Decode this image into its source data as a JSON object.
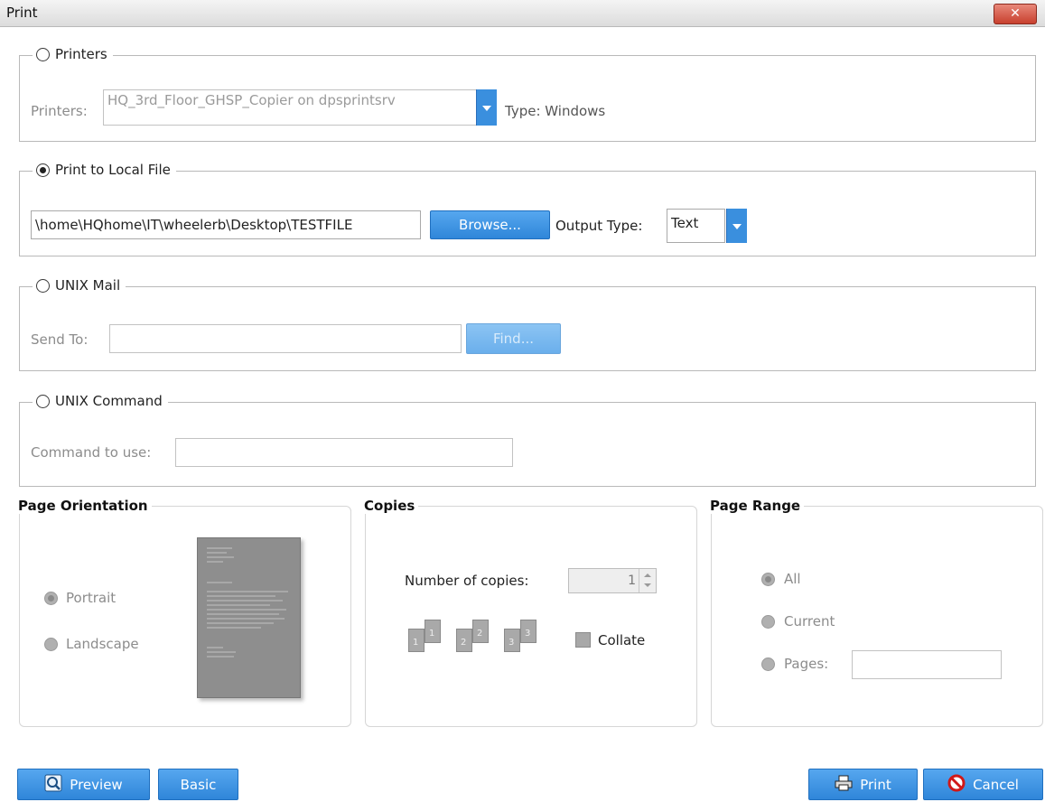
{
  "window": {
    "title": "Print",
    "close_label": "✕"
  },
  "printers": {
    "legend": "Printers",
    "label": "Printers:",
    "value": "HQ_3rd_Floor_GHSP_Copier on dpsprintsrv",
    "type_text": "Type: Windows"
  },
  "local_file": {
    "legend": "Print to Local File",
    "path": "\\home\\HQhome\\IT\\wheelerb\\Desktop\\TESTFILE",
    "browse_label": "Browse...",
    "output_type_label": "Output Type:",
    "output_type_value": "Text"
  },
  "unix_mail": {
    "legend": "UNIX Mail",
    "send_to_label": "Send To:",
    "send_to_value": "",
    "find_label": "Find..."
  },
  "unix_command": {
    "legend": "UNIX Command",
    "command_label": "Command to use:",
    "command_value": ""
  },
  "orientation": {
    "title": "Page Orientation",
    "portrait_label": "Portrait",
    "landscape_label": "Landscape"
  },
  "copies": {
    "title": "Copies",
    "number_label": "Number of copies:",
    "number_value": "1",
    "collate_label": "Collate",
    "page_numbers": [
      "1",
      "1",
      "2",
      "2",
      "3",
      "3"
    ]
  },
  "page_range": {
    "title": "Page Range",
    "all_label": "All",
    "current_label": "Current",
    "pages_label": "Pages:",
    "pages_value": ""
  },
  "footer": {
    "preview_label": "Preview",
    "basic_label": "Basic",
    "print_label": "Print",
    "cancel_label": "Cancel"
  },
  "icons": {
    "preview": "magnifier-icon",
    "print": "printer-icon",
    "cancel": "no-entry-icon"
  },
  "colors": {
    "button_blue": "#3a8fde",
    "close_red": "#c8402e"
  }
}
